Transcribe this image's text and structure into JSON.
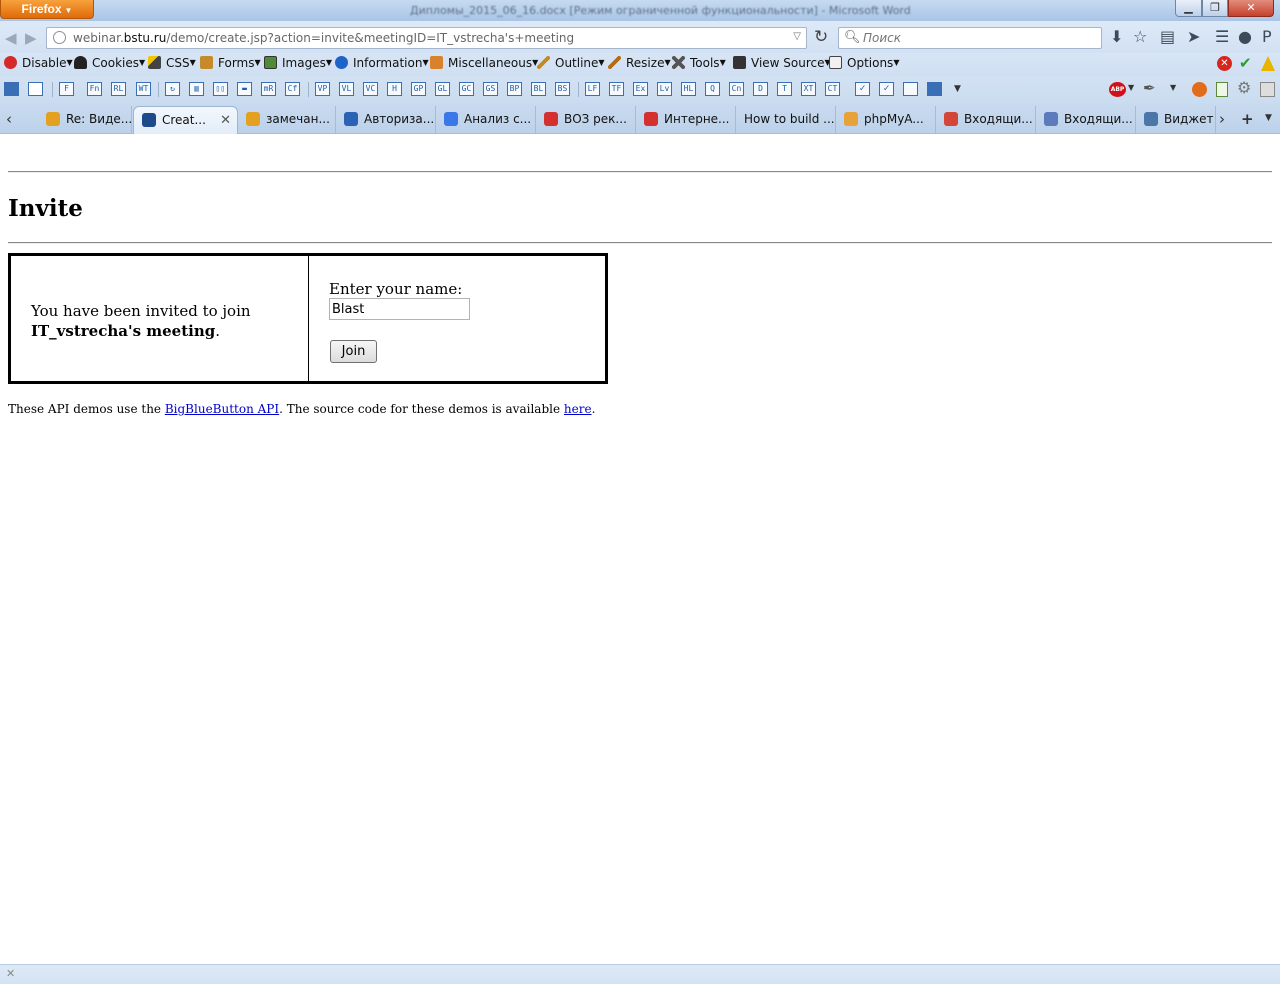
{
  "browser": {
    "app_button": "Firefox",
    "window_title": "Дипломы_2015_06_16.docx [Режим ограниченной функциональности] - Microsoft Word",
    "url": "webinar.bstu.ru/demo/create.jsp?action=invite&meetingID=IT_vstrecha's+meeting",
    "url_domain_prefix": "webinar.",
    "url_domain": "bstu.ru",
    "url_path": "/demo/create.jsp?action=invite&meetingID=IT_vstrecha's+meeting",
    "search_placeholder": "Поиск"
  },
  "devtoolbar": {
    "items": [
      "Disable",
      "Cookies",
      "CSS",
      "Forms",
      "Images",
      "Information",
      "Miscellaneous",
      "Outline",
      "Resize",
      "Tools",
      "View Source",
      "Options"
    ]
  },
  "buttonbar": {
    "buttons": [
      "F",
      "Fn",
      "RL",
      "WT",
      "↻",
      "▥",
      "▯▯",
      "▬",
      "mR",
      "Cf",
      "VP",
      "VL",
      "VC",
      "H",
      "GP",
      "GL",
      "GC",
      "GS",
      "BP",
      "BL",
      "BS",
      "LF",
      "TF",
      "Ex",
      "Lv",
      "HL",
      "Q",
      "Cn",
      "D",
      "T",
      "XT",
      "CT"
    ]
  },
  "tabs": [
    {
      "label": "Re: Виде...",
      "favicon": "#e4a021"
    },
    {
      "label": "Creat...",
      "favicon": "#1d4a8a",
      "active": true
    },
    {
      "label": "замечан...",
      "favicon": "#e4a021"
    },
    {
      "label": "Авториза...",
      "favicon": "#2a63b3"
    },
    {
      "label": "Анализ с...",
      "favicon": "#3b78e7"
    },
    {
      "label": "ВОЗ рек...",
      "favicon": "#d43030"
    },
    {
      "label": "Интерне...",
      "favicon": "#d43030"
    },
    {
      "label": "How to build ...",
      "favicon": ""
    },
    {
      "label": "phpMyA...",
      "favicon": "#e8a23a"
    },
    {
      "label": "Входящи...",
      "favicon": "#d44638"
    },
    {
      "label": "Входящи...",
      "favicon": "#5b7bbd"
    },
    {
      "label": "Виджет ...",
      "favicon": "#4a76a8"
    }
  ],
  "page": {
    "title": "Invite",
    "invite_prefix": "You have been invited to join",
    "meeting_name": "IT_vstrecha's meeting",
    "invite_suffix": ".",
    "name_label": "Enter your name:",
    "name_value": "Blast",
    "join_label": "Join",
    "footer_before": "These API demos use the ",
    "footer_link1": "BigBlueButton API",
    "footer_middle": ". The source code for these demos is available ",
    "footer_link2": "here",
    "footer_after": "."
  }
}
